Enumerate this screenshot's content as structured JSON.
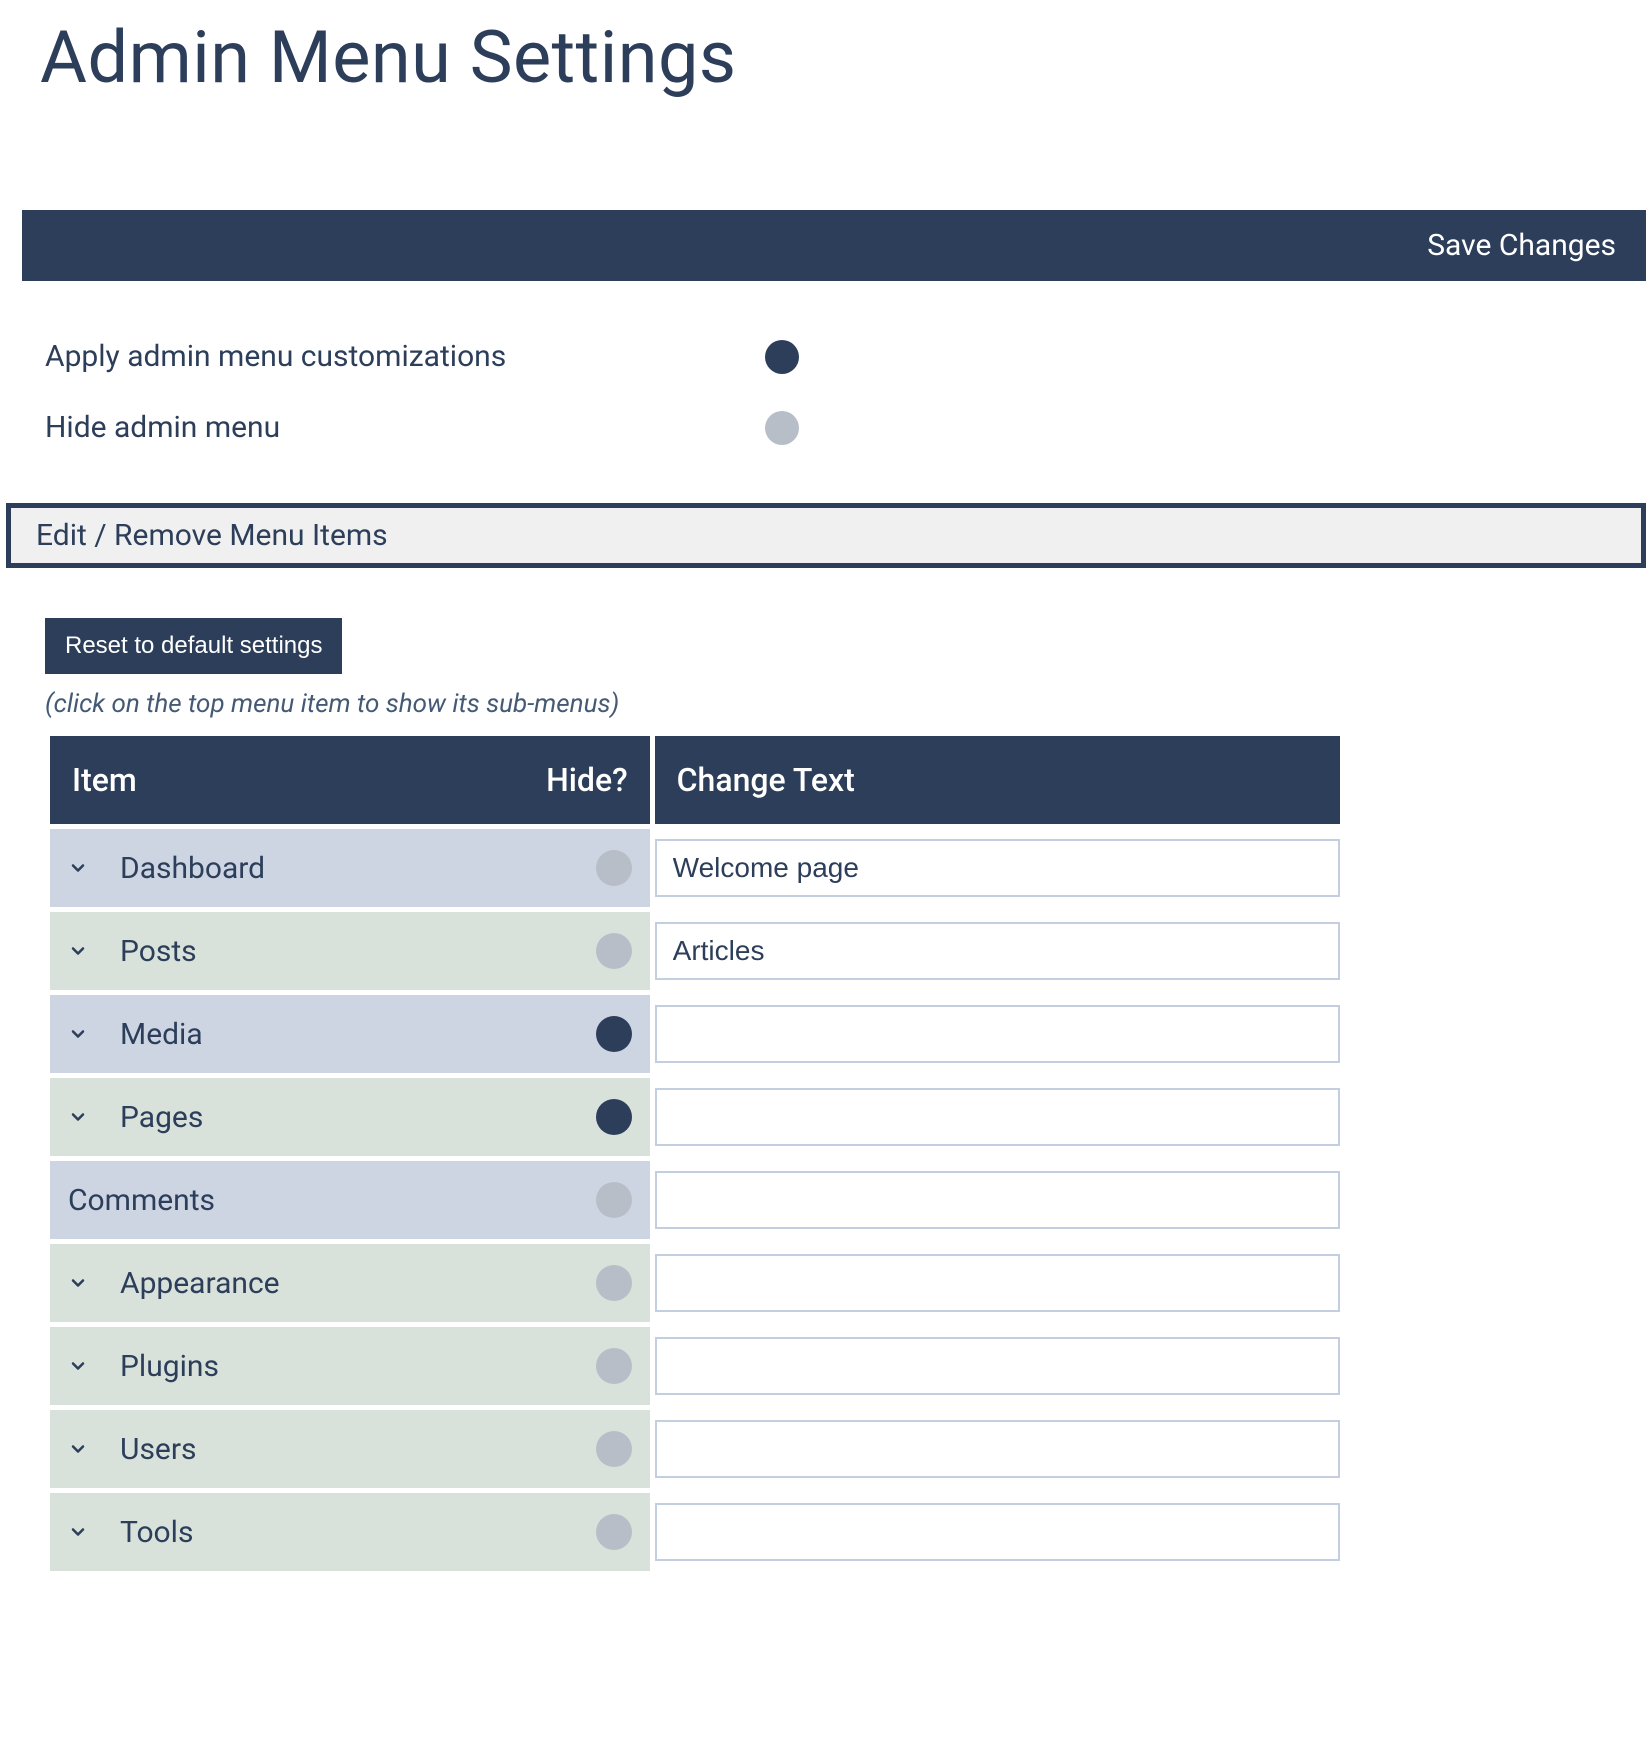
{
  "page": {
    "title": "Admin Menu Settings"
  },
  "saveBar": {
    "label": "Save Changes"
  },
  "options": {
    "applyCustomizations": {
      "label": "Apply admin menu customizations",
      "enabled": true
    },
    "hideAdminMenu": {
      "label": "Hide admin menu",
      "enabled": false
    }
  },
  "section": {
    "title": "Edit / Remove Menu Items"
  },
  "resetButton": {
    "label": "Reset to default settings"
  },
  "hint": "(click on the top menu item to show its sub-menus)",
  "table": {
    "headers": {
      "item": "Item",
      "hide": "Hide?",
      "changeText": "Change Text"
    },
    "rows": [
      {
        "name": "Dashboard",
        "hasChevron": true,
        "hidden": false,
        "changeText": "Welcome page",
        "colorClass": "row-blue"
      },
      {
        "name": "Posts",
        "hasChevron": true,
        "hidden": false,
        "changeText": "Articles",
        "colorClass": "row-green"
      },
      {
        "name": "Media",
        "hasChevron": true,
        "hidden": true,
        "changeText": "",
        "colorClass": "row-blue"
      },
      {
        "name": "Pages",
        "hasChevron": true,
        "hidden": true,
        "changeText": "",
        "colorClass": "row-green"
      },
      {
        "name": "Comments",
        "hasChevron": false,
        "hidden": false,
        "changeText": "",
        "colorClass": "row-blue"
      },
      {
        "name": "Appearance",
        "hasChevron": true,
        "hidden": false,
        "changeText": "",
        "colorClass": "row-green"
      },
      {
        "name": "Plugins",
        "hasChevron": true,
        "hidden": false,
        "changeText": "",
        "colorClass": "row-green"
      },
      {
        "name": "Users",
        "hasChevron": true,
        "hidden": false,
        "changeText": "",
        "colorClass": "row-green"
      },
      {
        "name": "Tools",
        "hasChevron": true,
        "hidden": false,
        "changeText": "",
        "colorClass": "row-green"
      }
    ]
  }
}
